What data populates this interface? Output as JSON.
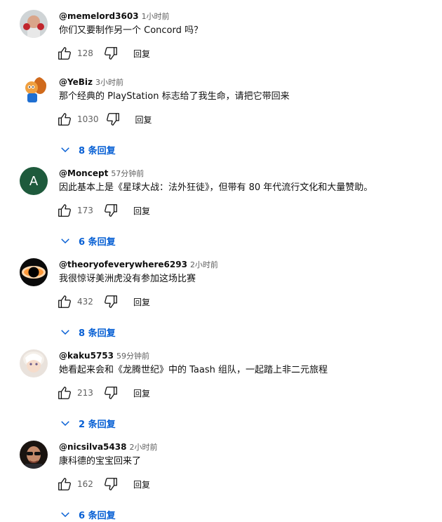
{
  "comments": [
    {
      "author": "@memelord3603",
      "time": "1小时前",
      "text": "你们又要制作另一个 Concord 吗？",
      "likes": "128",
      "reply_label": "回复",
      "replies_label": "",
      "avatar_icon": "boxer-avatar-icon",
      "avatar_letter": ""
    },
    {
      "author": "@YeBiz",
      "time": "3小时前",
      "text": "那个经典的 PlayStation 标志给了我生命，请把它带回来",
      "likes": "1030",
      "reply_label": "回复",
      "replies_label": "8 条回复",
      "avatar_icon": "squirrel-avatar-icon",
      "avatar_letter": ""
    },
    {
      "author": "@Moncept",
      "time": "57分钟前",
      "text": "因此基本上是《星球大战：法外狂徒》，但带有 80 年代流行文化和大量赞助。",
      "likes": "173",
      "reply_label": "回复",
      "replies_label": "6 条回复",
      "avatar_icon": "letter-avatar-icon",
      "avatar_letter": "A"
    },
    {
      "author": "@theoryofeverywhere6293",
      "time": "2小时前",
      "text": "我很惊讶美洲虎没有参加这场比赛",
      "likes": "432",
      "reply_label": "回复",
      "replies_label": "8 条回复",
      "avatar_icon": "black-hole-avatar-icon",
      "avatar_letter": ""
    },
    {
      "author": "@kaku5753",
      "time": "59分钟前",
      "text": "她看起来会和《龙腾世纪》中的 Taash 组队，一起踏上非二元旅程",
      "likes": "213",
      "reply_label": "回复",
      "replies_label": "2 条回复",
      "avatar_icon": "anime-girl-avatar-icon",
      "avatar_letter": ""
    },
    {
      "author": "@nicsilva5438",
      "time": "2小时前",
      "text": "康科德的宝宝回来了",
      "likes": "162",
      "reply_label": "回复",
      "replies_label": "6 条回复",
      "avatar_icon": "man-sunglasses-avatar-icon",
      "avatar_letter": ""
    }
  ],
  "colors": {
    "link_blue": "#065fd4",
    "secondary_text": "#606060",
    "primary_text": "#0f0f0f",
    "letter_avatar_bg": "#1e5a3c"
  },
  "icons": {
    "like": "thumbs-up-icon",
    "dislike": "thumbs-down-icon",
    "expand": "chevron-down-icon"
  }
}
